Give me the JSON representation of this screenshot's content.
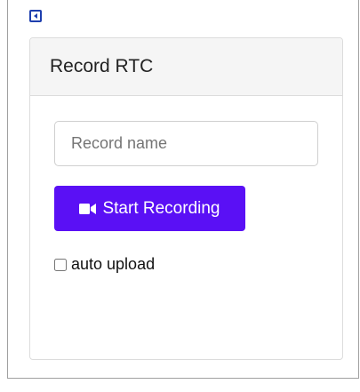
{
  "panel": {
    "title": "Record RTC"
  },
  "record": {
    "name_placeholder": "Record name",
    "name_value": "",
    "start_label": "Start Recording",
    "start_icon": "video-camera-icon",
    "auto_upload_label": "auto upload",
    "auto_upload_checked": false
  },
  "colors": {
    "accent": "#5a10f5",
    "collapse_icon": "#1e3fae"
  }
}
